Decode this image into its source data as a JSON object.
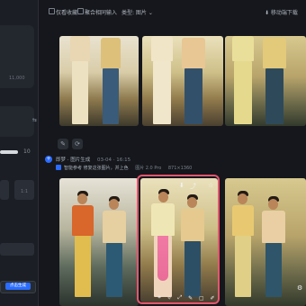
{
  "topbar": {
    "favorites_label": "仅看收藏",
    "aggregate_label": "聚合相同输入",
    "type_label": "类型: 图片 ⌄",
    "move_label": "⬇ 移动端下载"
  },
  "left_panel": {
    "value_a": "11,000",
    "slider_value": "10",
    "option_a": "1:1",
    "button_label": "点击生成"
  },
  "task": {
    "title": "即梦 · 图片生成",
    "time": "03-04 · 16:15",
    "prompt": "智能参考 修复这张图片，并上色",
    "model": "图片 2.0 Pro",
    "size": "871×1360"
  },
  "overlay_icons": [
    "tool-icon",
    "magic-icon",
    "expand-icon",
    "brush-icon",
    "crop-icon",
    "edit-icon"
  ],
  "colors": {
    "accent": "#2b6cff",
    "highlight": "#e5566c"
  }
}
